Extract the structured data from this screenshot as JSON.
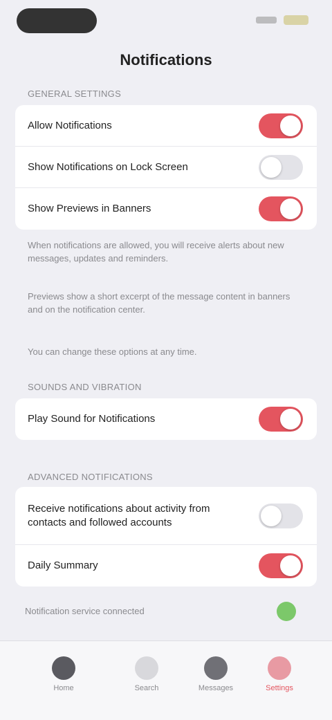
{
  "status_bar": {
    "icons": [
      "signal-icon",
      "battery-icon"
    ]
  },
  "header": {
    "title": "Notifications"
  },
  "sections": {
    "general": {
      "header": "GENERAL SETTINGS",
      "rows": [
        {
          "label": "Allow Notifications",
          "enabled": true
        },
        {
          "label": "Show Notifications on Lock Screen",
          "enabled": false
        },
        {
          "label": "Show Previews in Banners",
          "enabled": true
        }
      ],
      "footnotes": [
        "When notifications are allowed, you will receive alerts about new messages, updates and reminders.",
        "Previews show a short excerpt of the message content in banners and on the notification center.",
        "You can change these options at any time."
      ]
    },
    "sounds": {
      "header": "SOUNDS AND VIBRATION",
      "rows": [
        {
          "label": "Play Sound for Notifications",
          "enabled": true
        }
      ]
    },
    "advanced": {
      "header": "ADVANCED NOTIFICATIONS",
      "rows": [
        {
          "label": "Receive notifications about activity from contacts and followed accounts",
          "enabled": false
        },
        {
          "label": "Daily Summary",
          "enabled": true
        }
      ]
    }
  },
  "sync_status": {
    "label": "Notification service connected",
    "color": "#7cc86a"
  },
  "tabbar": {
    "tabs": [
      {
        "label": "Home",
        "icon": "home-icon",
        "color": "#5a5a60"
      },
      {
        "label": "Search",
        "icon": "search-icon",
        "color": "#d8d8dc"
      },
      {
        "label": "Messages",
        "icon": "chat-icon",
        "color": "#707076"
      },
      {
        "label": "Settings",
        "icon": "gear-icon",
        "color": "#e89aa3",
        "active": true
      }
    ]
  },
  "colors": {
    "accent": "#e4555f",
    "toggle_off": "#e3e3e8",
    "background": "#efeff4"
  }
}
